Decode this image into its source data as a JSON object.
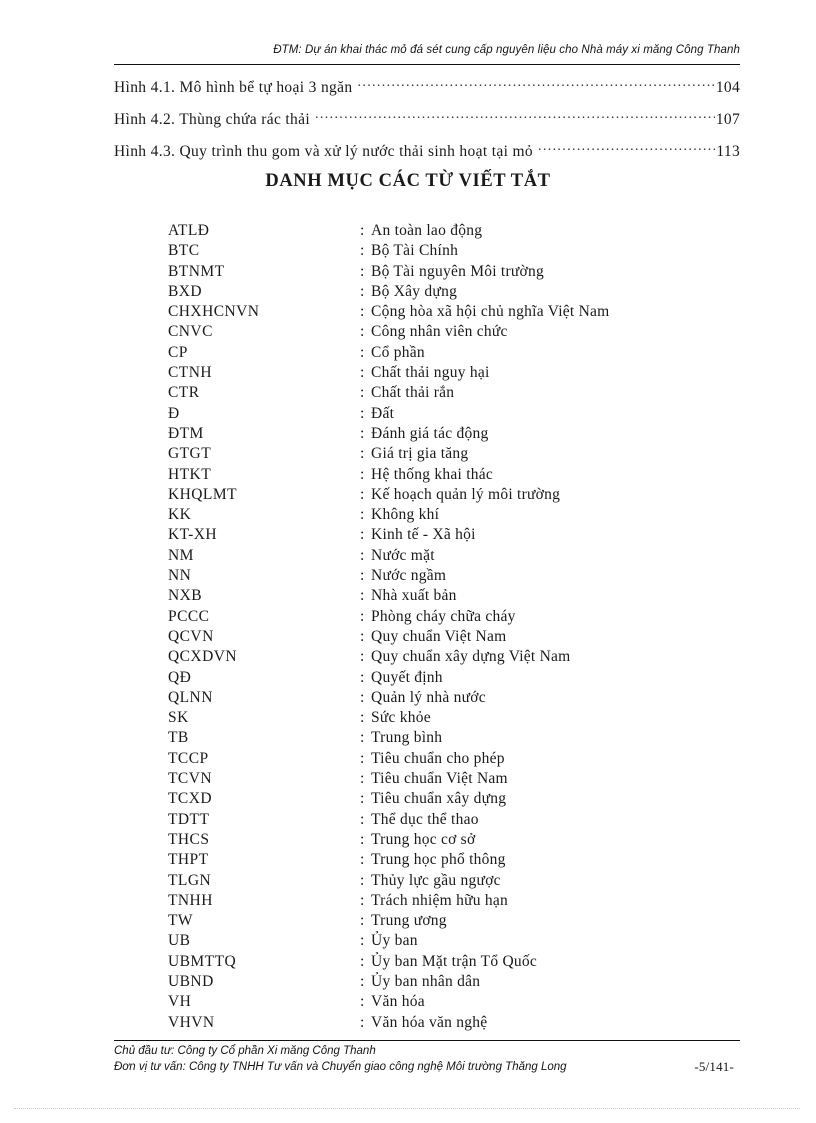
{
  "header": {
    "running_title": "ĐTM: Dự án khai thác mỏ đá sét cung cấp nguyên liệu cho Nhà máy xi măng Công Thanh"
  },
  "toc": {
    "entries": [
      {
        "label": "Hình 4.1. Mô hình bể tự hoại 3 ngăn",
        "page": "104"
      },
      {
        "label": "Hình 4.2. Thùng chứa rác thải",
        "page": "107"
      },
      {
        "label": "Hình 4.3. Quy trình thu gom và xử lý nước thải sinh hoạt tại mỏ",
        "page": "113"
      }
    ]
  },
  "section": {
    "title": "DANH MỤC CÁC TỪ VIẾT TẮT"
  },
  "abbreviations": [
    {
      "term": "ATLĐ",
      "definition": "An toàn lao động"
    },
    {
      "term": "BTC",
      "definition": "Bộ Tài Chính"
    },
    {
      "term": "BTNMT",
      "definition": "Bộ Tài nguyên Môi trường"
    },
    {
      "term": "BXD",
      "definition": "Bộ Xây dựng"
    },
    {
      "term": "CHXHCNVN",
      "definition": "Cộng hòa xã hội chủ nghĩa Việt Nam"
    },
    {
      "term": "CNVC",
      "definition": "Công nhân viên chức"
    },
    {
      "term": "CP",
      "definition": "Cổ phần"
    },
    {
      "term": "CTNH",
      "definition": "Chất thải nguy hại"
    },
    {
      "term": "CTR",
      "definition": "Chất thải rắn"
    },
    {
      "term": "Đ",
      "definition": "Đất"
    },
    {
      "term": "ĐTM",
      "definition": "Đánh giá tác động"
    },
    {
      "term": "GTGT",
      "definition": "Giá trị gia tăng"
    },
    {
      "term": "HTKT",
      "definition": "Hệ thống khai thác"
    },
    {
      "term": "KHQLMT",
      "definition": "Kế hoạch quản lý môi trường"
    },
    {
      "term": "KK",
      "definition": "Không khí"
    },
    {
      "term": "KT-XH",
      "definition": "Kinh tế - Xã hội"
    },
    {
      "term": "NM",
      "definition": "Nước mặt"
    },
    {
      "term": "NN",
      "definition": "Nước ngầm"
    },
    {
      "term": "NXB",
      "definition": "Nhà xuất bản"
    },
    {
      "term": "PCCC",
      "definition": "Phòng cháy chữa cháy"
    },
    {
      "term": "QCVN",
      "definition": "Quy chuẩn Việt Nam"
    },
    {
      "term": "QCXDVN",
      "definition": "Quy chuẩn xây dựng Việt Nam"
    },
    {
      "term": "QĐ",
      "definition": "Quyết định"
    },
    {
      "term": "QLNN",
      "definition": "Quản lý nhà nước"
    },
    {
      "term": "SK",
      "definition": "Sức khỏe"
    },
    {
      "term": "TB",
      "definition": "Trung bình"
    },
    {
      "term": "TCCP",
      "definition": "Tiêu chuẩn cho phép"
    },
    {
      "term": "TCVN",
      "definition": "Tiêu chuẩn Việt Nam"
    },
    {
      "term": "TCXD",
      "definition": "Tiêu chuẩn xây dựng"
    },
    {
      "term": "TDTT",
      "definition": "Thể dục thể thao"
    },
    {
      "term": "THCS",
      "definition": "Trung học cơ sở"
    },
    {
      "term": "THPT",
      "definition": "Trung học phổ thông"
    },
    {
      "term": "TLGN",
      "definition": "Thủy lực gầu ngược"
    },
    {
      "term": "TNHH",
      "definition": "Trách nhiệm hữu hạn"
    },
    {
      "term": "TW",
      "definition": "Trung ương"
    },
    {
      "term": "UB",
      "definition": "Ủy ban"
    },
    {
      "term": "UBMTTQ",
      "definition": "Ủy ban Mặt trận Tổ Quốc"
    },
    {
      "term": "UBND",
      "definition": "Ủy ban nhân dân"
    },
    {
      "term": "VH",
      "definition": "Văn hóa"
    },
    {
      "term": "VHVN",
      "definition": "Văn hóa văn nghệ"
    }
  ],
  "footer": {
    "investor_line": "Chủ đầu tư: Công ty Cổ phần Xi măng Công Thanh",
    "consultant_line": "Đơn vị tư vấn: Công ty TNHH Tư vấn và Chuyển giao công nghệ Môi trường Thăng Long",
    "page_number": "-5/141-"
  },
  "separator": ":"
}
